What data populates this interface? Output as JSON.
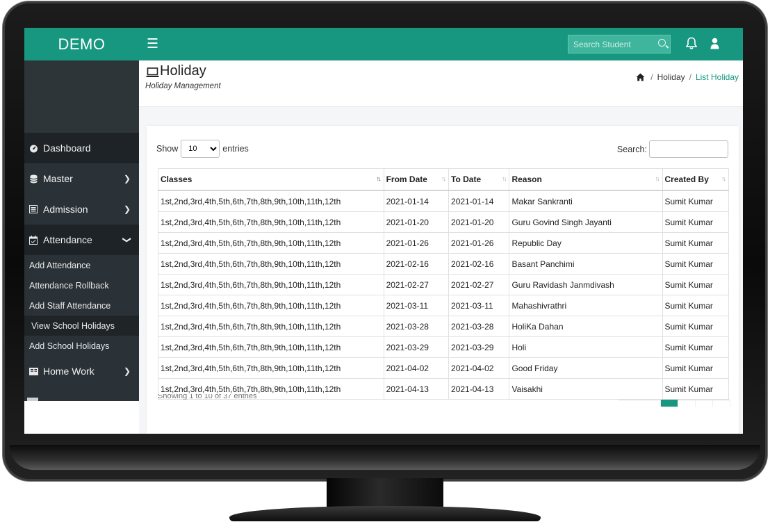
{
  "colors": {
    "accent": "#17977f",
    "sidebar": "#2b3237",
    "sidebar_dark": "#1e2327"
  },
  "brand": "DEMO",
  "topbar": {
    "menu_icon": "hamburger-icon",
    "search_placeholder": "Search Student",
    "icons": [
      "search-icon",
      "bell-icon",
      "user-icon"
    ]
  },
  "sidebar": {
    "items": [
      {
        "label": "Dashboard",
        "icon": "dashboard-icon"
      },
      {
        "label": "Master",
        "icon": "database-icon"
      },
      {
        "label": "Admission",
        "icon": "form-icon"
      },
      {
        "label": "Attendance",
        "icon": "calendar-icon"
      }
    ],
    "attendance_sub": [
      {
        "label": "Add Attendance"
      },
      {
        "label": "Attendance Rollback"
      },
      {
        "label": "Add Staff Attendance"
      },
      {
        "label": "View School Holidays"
      },
      {
        "label": "Add School Holidays"
      }
    ],
    "after": [
      {
        "label": "Home Work",
        "icon": "book-icon"
      }
    ]
  },
  "page": {
    "title": "Holiday",
    "subtitle": "Holiday Management",
    "breadcrumb": [
      "Holiday",
      "List Holiday"
    ]
  },
  "table_controls": {
    "show_label": "Show",
    "entries_value": "10",
    "entries_label": "entries",
    "search_label": "Search:"
  },
  "table": {
    "headers": [
      "Classes",
      "From Date",
      "To Date",
      "Reason",
      "Created By"
    ],
    "rows": [
      [
        "1st,2nd,3rd,4th,5th,6th,7th,8th,9th,10th,11th,12th",
        "2021-01-14",
        "2021-01-14",
        "Makar Sankranti",
        "Sumit Kumar"
      ],
      [
        "1st,2nd,3rd,4th,5th,6th,7th,8th,9th,10th,11th,12th",
        "2021-01-20",
        "2021-01-20",
        "Guru Govind Singh Jayanti",
        "Sumit Kumar"
      ],
      [
        "1st,2nd,3rd,4th,5th,6th,7th,8th,9th,10th,11th,12th",
        "2021-01-26",
        "2021-01-26",
        "Republic Day",
        "Sumit Kumar"
      ],
      [
        "1st,2nd,3rd,4th,5th,6th,7th,8th,9th,10th,11th,12th",
        "2021-02-16",
        "2021-02-16",
        "Basant Panchimi",
        "Sumit Kumar"
      ],
      [
        "1st,2nd,3rd,4th,5th,6th,7th,8th,9th,10th,11th,12th",
        "2021-02-27",
        "2021-02-27",
        "Guru Ravidash Janmdivash",
        "Sumit Kumar"
      ],
      [
        "1st,2nd,3rd,4th,5th,6th,7th,8th,9th,10th,11th,12th",
        "2021-03-11",
        "2021-03-11",
        "Mahashivrathri",
        "Sumit Kumar"
      ],
      [
        "1st,2nd,3rd,4th,5th,6th,7th,8th,9th,10th,11th,12th",
        "2021-03-28",
        "2021-03-28",
        "HoliKa Dahan",
        "Sumit Kumar"
      ],
      [
        "1st,2nd,3rd,4th,5th,6th,7th,8th,9th,10th,11th,12th",
        "2021-03-29",
        "2021-03-29",
        "Holi",
        "Sumit Kumar"
      ],
      [
        "1st,2nd,3rd,4th,5th,6th,7th,8th,9th,10th,11th,12th",
        "2021-04-02",
        "2021-04-02",
        "Good Friday",
        "Sumit Kumar"
      ],
      [
        "1st,2nd,3rd,4th,5th,6th,7th,8th,9th,10th,11th,12th",
        "2021-04-13",
        "2021-04-13",
        "Vaisakhi",
        "Sumit Kumar"
      ]
    ]
  },
  "table_info": "Showing 1 to 10 of 37 entries"
}
